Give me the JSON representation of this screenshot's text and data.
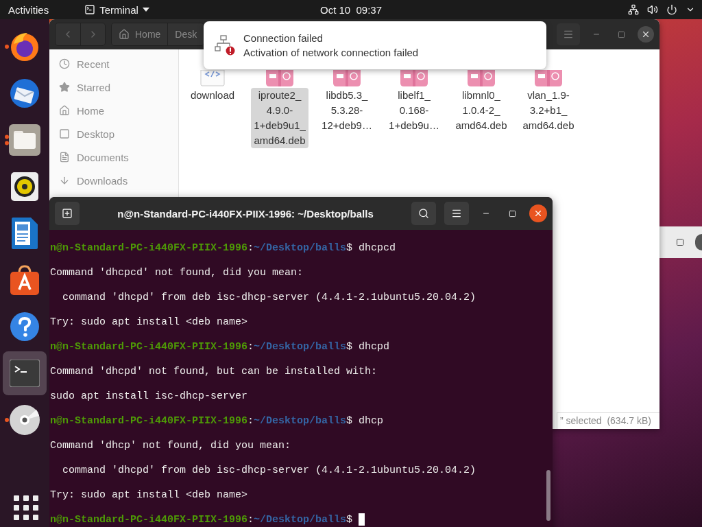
{
  "top_bar": {
    "activities": "Activities",
    "app_menu": "Terminal",
    "clock": "Oct 10  09:37"
  },
  "dock": {
    "items": [
      {
        "kind": "firefox",
        "running": true,
        "multiple": false,
        "selected": false
      },
      {
        "kind": "thunderbird",
        "running": false,
        "selected": false
      },
      {
        "kind": "files",
        "running": true,
        "multiple": true,
        "selected": false
      },
      {
        "kind": "rhythmbox",
        "running": false,
        "selected": false
      },
      {
        "kind": "writer",
        "running": false,
        "selected": false
      },
      {
        "kind": "software",
        "running": false,
        "selected": false
      },
      {
        "kind": "help",
        "running": false,
        "selected": false
      },
      {
        "kind": "terminal",
        "running": false,
        "selected": true
      },
      {
        "kind": "disc",
        "running": true,
        "multiple": false,
        "selected": false
      }
    ]
  },
  "files_window": {
    "path": [
      "Home",
      "Desk"
    ],
    "sidebar": [
      {
        "kind": "recent",
        "label": "Recent"
      },
      {
        "kind": "starred",
        "label": "Starred"
      },
      {
        "kind": "home",
        "label": "Home"
      },
      {
        "kind": "desktop",
        "label": "Desktop"
      },
      {
        "kind": "documents",
        "label": "Documents"
      },
      {
        "kind": "downloads",
        "label": "Downloads"
      }
    ],
    "files": [
      {
        "kind": "code",
        "name_lines": [
          "download"
        ],
        "selected": false
      },
      {
        "kind": "deb",
        "name_lines": [
          "iproute2_",
          "4.9.0-",
          "1+deb9u1_",
          "amd64.deb"
        ],
        "selected": true
      },
      {
        "kind": "deb",
        "name_lines": [
          "libdb5.3_",
          "5.3.28-",
          "12+deb9…"
        ],
        "selected": false
      },
      {
        "kind": "deb",
        "name_lines": [
          "libelf1_",
          "0.168-",
          "1+deb9u…"
        ],
        "selected": false
      },
      {
        "kind": "deb",
        "name_lines": [
          "libmnl0_",
          "1.0.4-2_",
          "amd64.deb"
        ],
        "selected": false
      },
      {
        "kind": "deb",
        "name_lines": [
          "vlan_1.9-",
          "3.2+b1_",
          "amd64.deb"
        ],
        "selected": false
      }
    ],
    "status": "” selected  (634.7 kB)"
  },
  "notification": {
    "title": "Connection failed",
    "body": "Activation of network connection failed"
  },
  "terminal": {
    "title": "n@n-Standard-PC-i440FX-PIIX-1996: ~/Desktop/balls",
    "lines": [
      {
        "kind": "prompt",
        "user": "n@n-Standard-PC-i440FX-PIIX-1996",
        "separator": ":",
        "path": "~/Desktop/balls",
        "symbol": "$ ",
        "command": "dhcpcd"
      },
      {
        "kind": "output",
        "text": "Command 'dhcpcd' not found, did you mean:"
      },
      {
        "kind": "output",
        "text": "  command 'dhcpd' from deb isc-dhcp-server (4.4.1-2.1ubuntu5.20.04.2)"
      },
      {
        "kind": "output",
        "text": "Try: sudo apt install <deb name>"
      },
      {
        "kind": "prompt",
        "user": "n@n-Standard-PC-i440FX-PIIX-1996",
        "separator": ":",
        "path": "~/Desktop/balls",
        "symbol": "$ ",
        "command": "dhcpd"
      },
      {
        "kind": "output",
        "text": "Command 'dhcpd' not found, but can be installed with:"
      },
      {
        "kind": "output",
        "text": "sudo apt install isc-dhcp-server"
      },
      {
        "kind": "prompt",
        "user": "n@n-Standard-PC-i440FX-PIIX-1996",
        "separator": ":",
        "path": "~/Desktop/balls",
        "symbol": "$ ",
        "command": "dhcp"
      },
      {
        "kind": "output",
        "text": "Command 'dhcp' not found, did you mean:"
      },
      {
        "kind": "output",
        "text": "  command 'dhcpd' from deb isc-dhcp-server (4.4.1-2.1ubuntu5.20.04.2)"
      },
      {
        "kind": "output",
        "text": "Try: sudo apt install <deb name>"
      },
      {
        "kind": "prompt",
        "user": "n@n-Standard-PC-i440FX-PIIX-1996",
        "separator": ":",
        "path": "~/Desktop/balls",
        "symbol": "$ ",
        "cursor": true
      }
    ]
  }
}
